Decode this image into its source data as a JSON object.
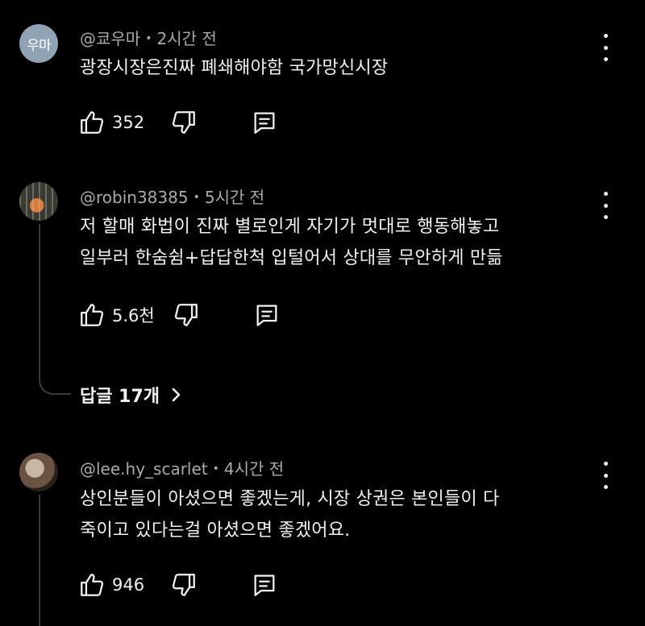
{
  "comments": [
    {
      "avatar_text": "우마",
      "author": "@쿄우마",
      "time": "2시간 전",
      "lines": [
        "광장시장은진짜 폐쇄해야함 국가망신시장"
      ],
      "likes": "352"
    },
    {
      "author": "@robin38385",
      "time": "5시간 전",
      "lines": [
        "저 할매 화법이 진짜 별로인게 자기가 멋대로 행동해놓고",
        "일부러 한숨쉼+답답한척 입털어서 상대를 무안하게 만듦"
      ],
      "likes": "5.6천",
      "replies_label": "답글 17개"
    },
    {
      "author": "@lee.hy_scarlet",
      "time": "4시간 전",
      "lines": [
        "상인분들이 아셨으면 좋겠는게, 시장 상권은 본인들이 다",
        "죽이고 있다는걸 아셨으면 좋겠어요."
      ],
      "likes": "946"
    }
  ],
  "separator": "•",
  "icons": {
    "like": "thumbs-up-icon",
    "dislike": "thumbs-down-icon",
    "reply": "comment-icon",
    "more": "more-vertical-icon",
    "chevron": "chevron-right-icon"
  },
  "colors": {
    "background": "#000000",
    "text": "#f1f1f1",
    "meta_text": "#aaaaaa",
    "avatar_bg": "#8fa3b5"
  }
}
